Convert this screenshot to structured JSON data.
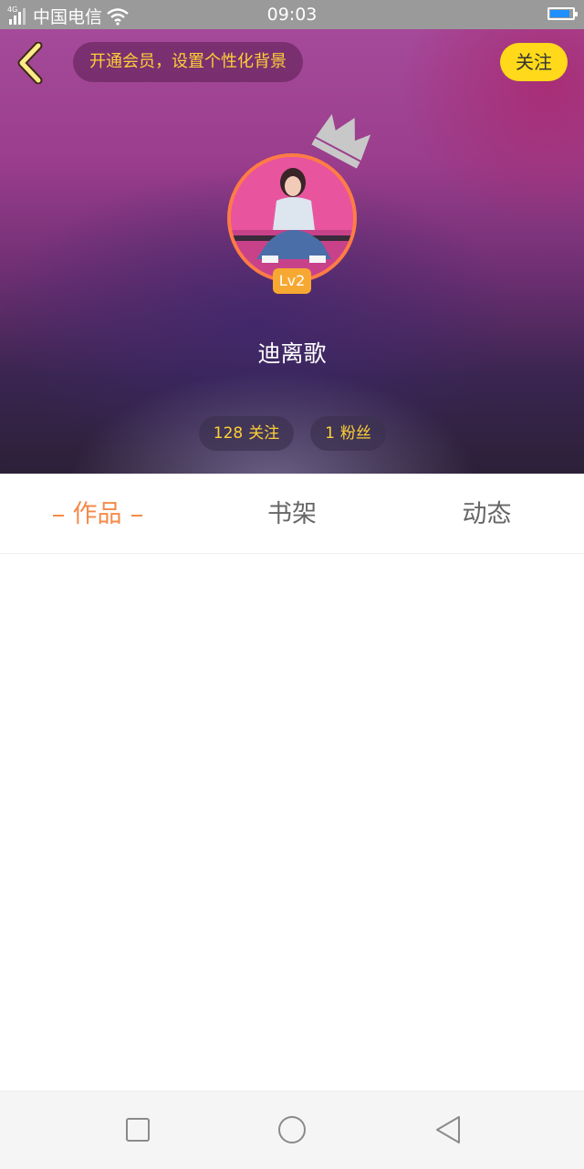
{
  "status_bar": {
    "network": "4G",
    "carrier": "中国电信",
    "time": "09:03",
    "battery_level": 0.9,
    "icons": [
      "signal-icon",
      "wifi-icon",
      "battery-icon"
    ]
  },
  "header": {
    "back_icon": "chevron-left-icon",
    "promo_text": "开通会员，设置个性化背景",
    "follow_label": "关注",
    "crown_icon": "crown-icon",
    "level_badge": "Lv2",
    "username": "迪离歌",
    "stats": {
      "following_count": "128",
      "following_label": "关注",
      "fans_count": "1",
      "fans_label": "粉丝"
    }
  },
  "tabs": [
    {
      "label": "作品",
      "active": true
    },
    {
      "label": "书架",
      "active": false
    },
    {
      "label": "动态",
      "active": false
    }
  ],
  "nav_bar": {
    "icons": [
      "square-icon",
      "circle-icon",
      "triangle-back-icon"
    ]
  },
  "colors": {
    "accent_orange": "#f48a48",
    "promo_yellow": "#ffcf36",
    "follow_button_yellow": "#ffd91a",
    "level_badge": "#f6a832",
    "avatar_ring": "#ff7c45",
    "status_bar_bg": "#9a9a9a",
    "battery_fill": "#1e90ff"
  }
}
